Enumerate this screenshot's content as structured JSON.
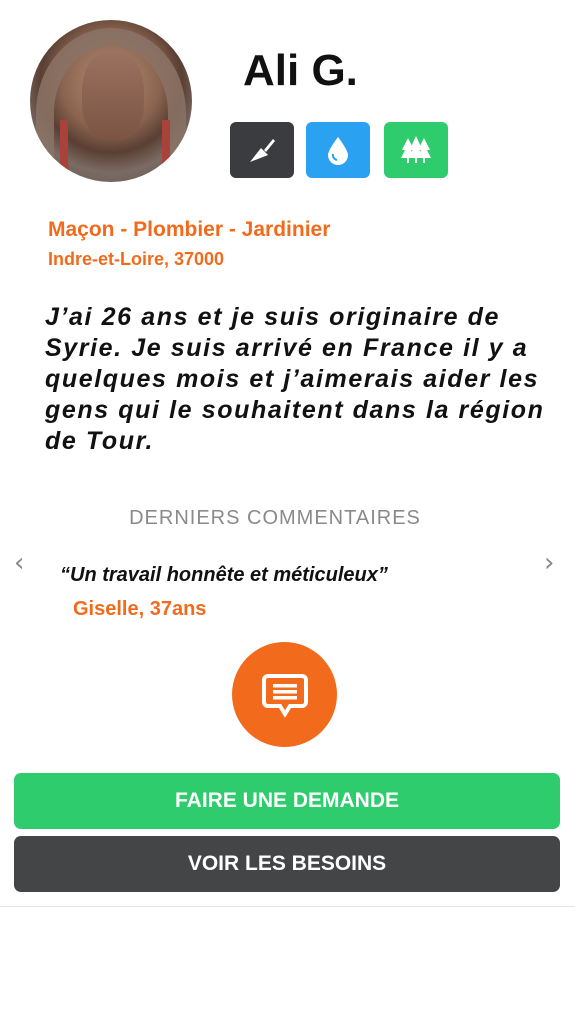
{
  "profile": {
    "name": "Ali G.",
    "trades": "Maçon - Plombier - Jardinier",
    "location": "Indre-et-Loire, 37000",
    "bio": "J’ai 26 ans et je suis originaire de Syrie. Je suis arrivé en France il y a quelques mois et j’aimerais aider les gens qui le souhaitent dans la région de Tour.",
    "skills": [
      {
        "icon": "trowel-icon",
        "color": "#3a3c40"
      },
      {
        "icon": "water-drop-icon",
        "color": "#2ba1f2"
      },
      {
        "icon": "trees-icon",
        "color": "#2ecc6d"
      }
    ]
  },
  "comments": {
    "title": "DERNIERS COMMENTAIRES",
    "quote": "“Un travail honnête et méticuleux”",
    "author": "Giselle, 37ans",
    "prev_icon": "chevron-left-icon",
    "next_icon": "chevron-right-icon",
    "prev_glyph": "‹",
    "next_glyph": "›"
  },
  "actions": {
    "request_label": "FAIRE UNE DEMANDE",
    "needs_label": "VOIR LES BESOINS",
    "comment_icon": "comment-icon"
  },
  "colors": {
    "accent": "#f26b1d",
    "green": "#2ecc6d",
    "dark": "#444546",
    "blue": "#2ba1f2"
  }
}
